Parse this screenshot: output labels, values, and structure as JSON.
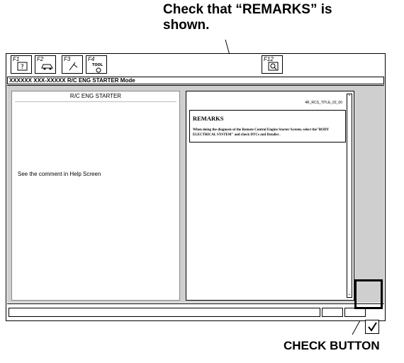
{
  "callouts": {
    "top": "Check that “REMARKS” is shown.",
    "bottom": "CHECK BUTTON"
  },
  "toolbar": {
    "keys": [
      {
        "label": "F1",
        "icon": "help-icon"
      },
      {
        "label": "F2",
        "icon": "vehicle-icon"
      },
      {
        "label": "F3",
        "icon": "tester-icon"
      },
      {
        "label": "F4",
        "icon": "tool-icon",
        "icon_text": "TOOL"
      },
      {
        "label": "F12",
        "icon": "zoom-icon"
      }
    ]
  },
  "mode_bar": "XXXXXX XXX-XXXXX R/C ENG STARTER Mode",
  "left_panel": {
    "title": "R/C ENG STARTER",
    "message": "See the comment in Help Screen"
  },
  "right_panel": {
    "doc_id": "4R_RCS_TITLE_02_00",
    "remarks_title": "REMARKS",
    "remarks_text": "When doing the diagnosis of the Remote Control Engine Starter System. select the\"BODY ELECTRICAL SYSTEM\" and check DTCs and Datalist ."
  },
  "check_button": {
    "icon": "check-icon"
  }
}
